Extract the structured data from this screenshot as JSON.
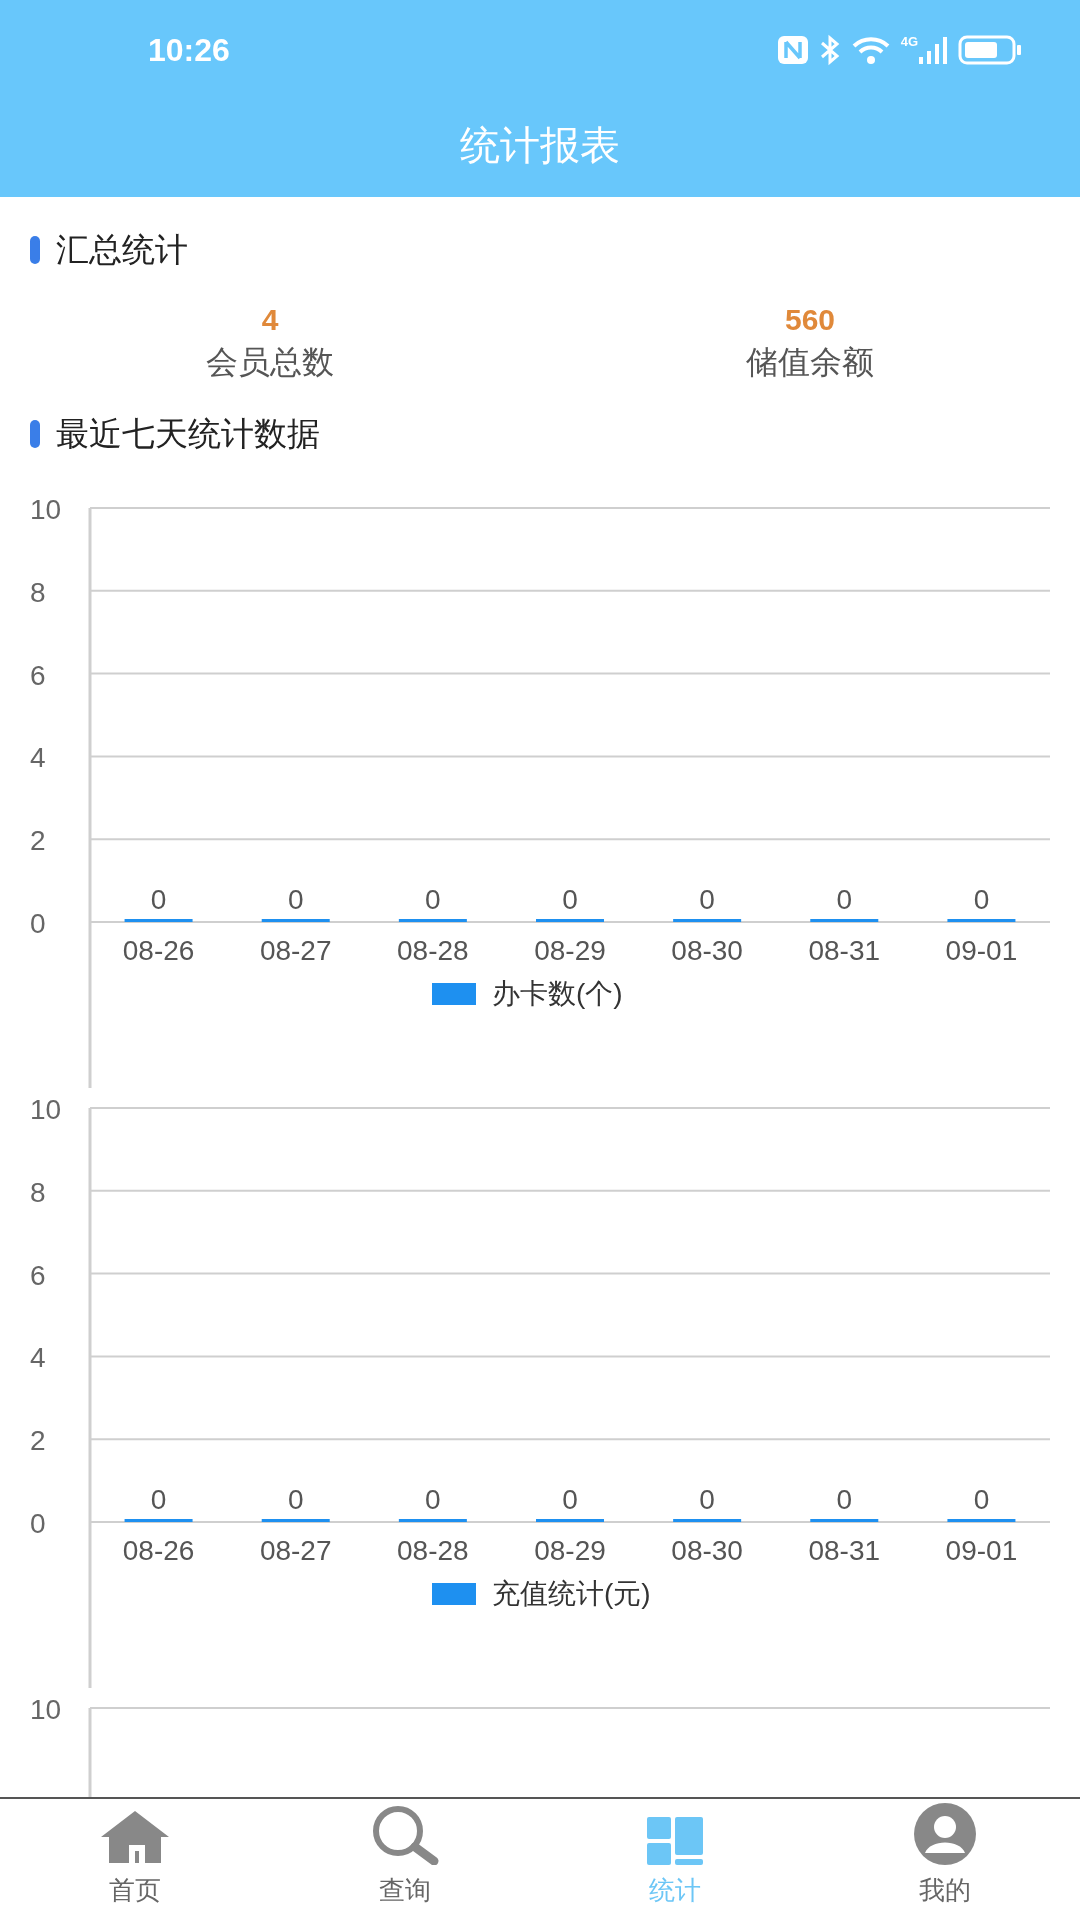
{
  "status_bar": {
    "time": "10:26",
    "network": "4G"
  },
  "header": {
    "title": "统计报表"
  },
  "summary": {
    "title": "汇总统计",
    "stats": [
      {
        "value": "4",
        "label": "会员总数"
      },
      {
        "value": "560",
        "label": "储值余额"
      }
    ]
  },
  "recent": {
    "title": "最近七天统计数据",
    "charts": [
      {
        "chart_data": {
          "type": "bar",
          "categories": [
            "08-26",
            "08-27",
            "08-28",
            "08-29",
            "08-30",
            "08-31",
            "09-01"
          ],
          "series": [
            {
              "name": "办卡数(个)",
              "color": "#1e90f0",
              "values": [
                0,
                0,
                0,
                0,
                0,
                0,
                0
              ]
            }
          ],
          "ylim": [
            0,
            10
          ],
          "yticks": [
            0,
            2,
            4,
            6,
            8,
            10
          ],
          "grid": true,
          "data_labels": true
        }
      },
      {
        "chart_data": {
          "type": "bar",
          "categories": [
            "08-26",
            "08-27",
            "08-28",
            "08-29",
            "08-30",
            "08-31",
            "09-01"
          ],
          "series": [
            {
              "name": "充值统计(元)",
              "color": "#1e90f0",
              "values": [
                0,
                0,
                0,
                0,
                0,
                0,
                0
              ]
            }
          ],
          "ylim": [
            0,
            10
          ],
          "yticks": [
            0,
            2,
            4,
            6,
            8,
            10
          ],
          "grid": true,
          "data_labels": true
        }
      },
      {
        "kind": "cut_off_chart",
        "top_label": "10"
      }
    ]
  },
  "tab_bar": [
    {
      "label": "首页",
      "kind": "home",
      "selected": false
    },
    {
      "label": "查询",
      "kind": "search",
      "selected": false
    },
    {
      "label": "统计",
      "kind": "stats",
      "selected": true
    },
    {
      "label": "我的",
      "kind": "profile",
      "selected": false
    }
  ]
}
